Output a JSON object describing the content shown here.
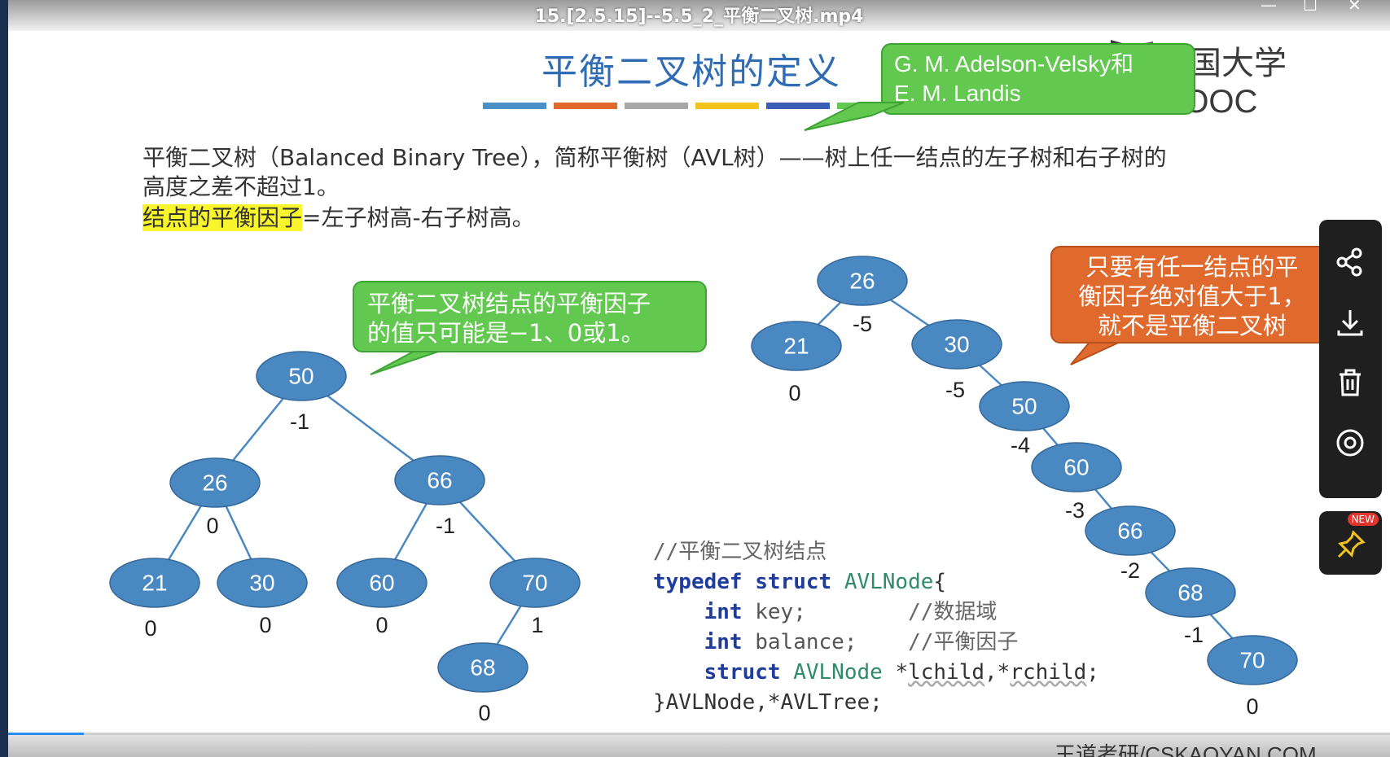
{
  "window": {
    "file_title": "15.[2.5.15]--5.5_2_平衡二叉树.mp4",
    "min": "—",
    "max": "☐",
    "close": "✕"
  },
  "slide": {
    "title": "平衡二叉树的定义",
    "color_bar": [
      "#4a90c9",
      "#e06a2c",
      "#a7a7a7",
      "#f2c21d",
      "#3a5fb6",
      "#62c84f"
    ],
    "authors_line1": "G. M. Adelson-Velsky和",
    "authors_line2": "E. M. Landis",
    "para_line1": "平衡二叉树（Balanced Binary Tree），简称平衡树（AVL树）——树上任一结点的左子树和右子树的",
    "para_line2": "高度之差不超过1。",
    "bf_highlight": "结点的平衡因子",
    "bf_rest": "=左子树高-右子树高。",
    "bubble_values_1": "平衡二叉树结点的平衡因子",
    "bubble_values_2": "的值只可能是−1、0或1。",
    "bubble_warn_1": "只要有任一结点的平",
    "bubble_warn_2": "衡因子绝对值大于1，",
    "bubble_warn_3": "就不是平衡二叉树"
  },
  "logo": {
    "text": "中国大学MOOC"
  },
  "tree_balanced": {
    "nodes": [
      {
        "key": "50",
        "bf": "-1"
      },
      {
        "key": "26",
        "bf": "0"
      },
      {
        "key": "66",
        "bf": "-1"
      },
      {
        "key": "21",
        "bf": "0"
      },
      {
        "key": "30",
        "bf": "0"
      },
      {
        "key": "60",
        "bf": "0"
      },
      {
        "key": "70",
        "bf": "1"
      },
      {
        "key": "68",
        "bf": "0"
      }
    ]
  },
  "tree_unbalanced": {
    "nodes": [
      {
        "key": "26",
        "bf": "-5"
      },
      {
        "key": "21",
        "bf": "0"
      },
      {
        "key": "30",
        "bf": "-5"
      },
      {
        "key": "50",
        "bf": "-4"
      },
      {
        "key": "60",
        "bf": "-3"
      },
      {
        "key": "66",
        "bf": "-2"
      },
      {
        "key": "68",
        "bf": "-1"
      },
      {
        "key": "70",
        "bf": "0"
      }
    ]
  },
  "code": {
    "comment": "//平衡二叉树结点",
    "typedef": "typedef",
    "struct": "struct",
    "type_name": "AVLNode",
    "brace_open": "{",
    "int": "int",
    "key": "key;",
    "key_comment": "//数据域",
    "balance": "balance;",
    "balance_comment": "//平衡因子",
    "ptr_fields_a": "*",
    "lchild": "lchild",
    "comma_star": ",*",
    "rchild": "rchild",
    "semi": ";",
    "closing": "}AVLNode,*AVLTree;"
  },
  "sidebar": {
    "share": "share-icon",
    "download": "download-icon",
    "delete": "trash-icon",
    "settings": "target-icon",
    "pin": "pin-icon",
    "new_badge": "NEW"
  },
  "player": {
    "progress": 0.055
  },
  "footer": {
    "url": "王道考研/CSKAOYAN.COM"
  }
}
